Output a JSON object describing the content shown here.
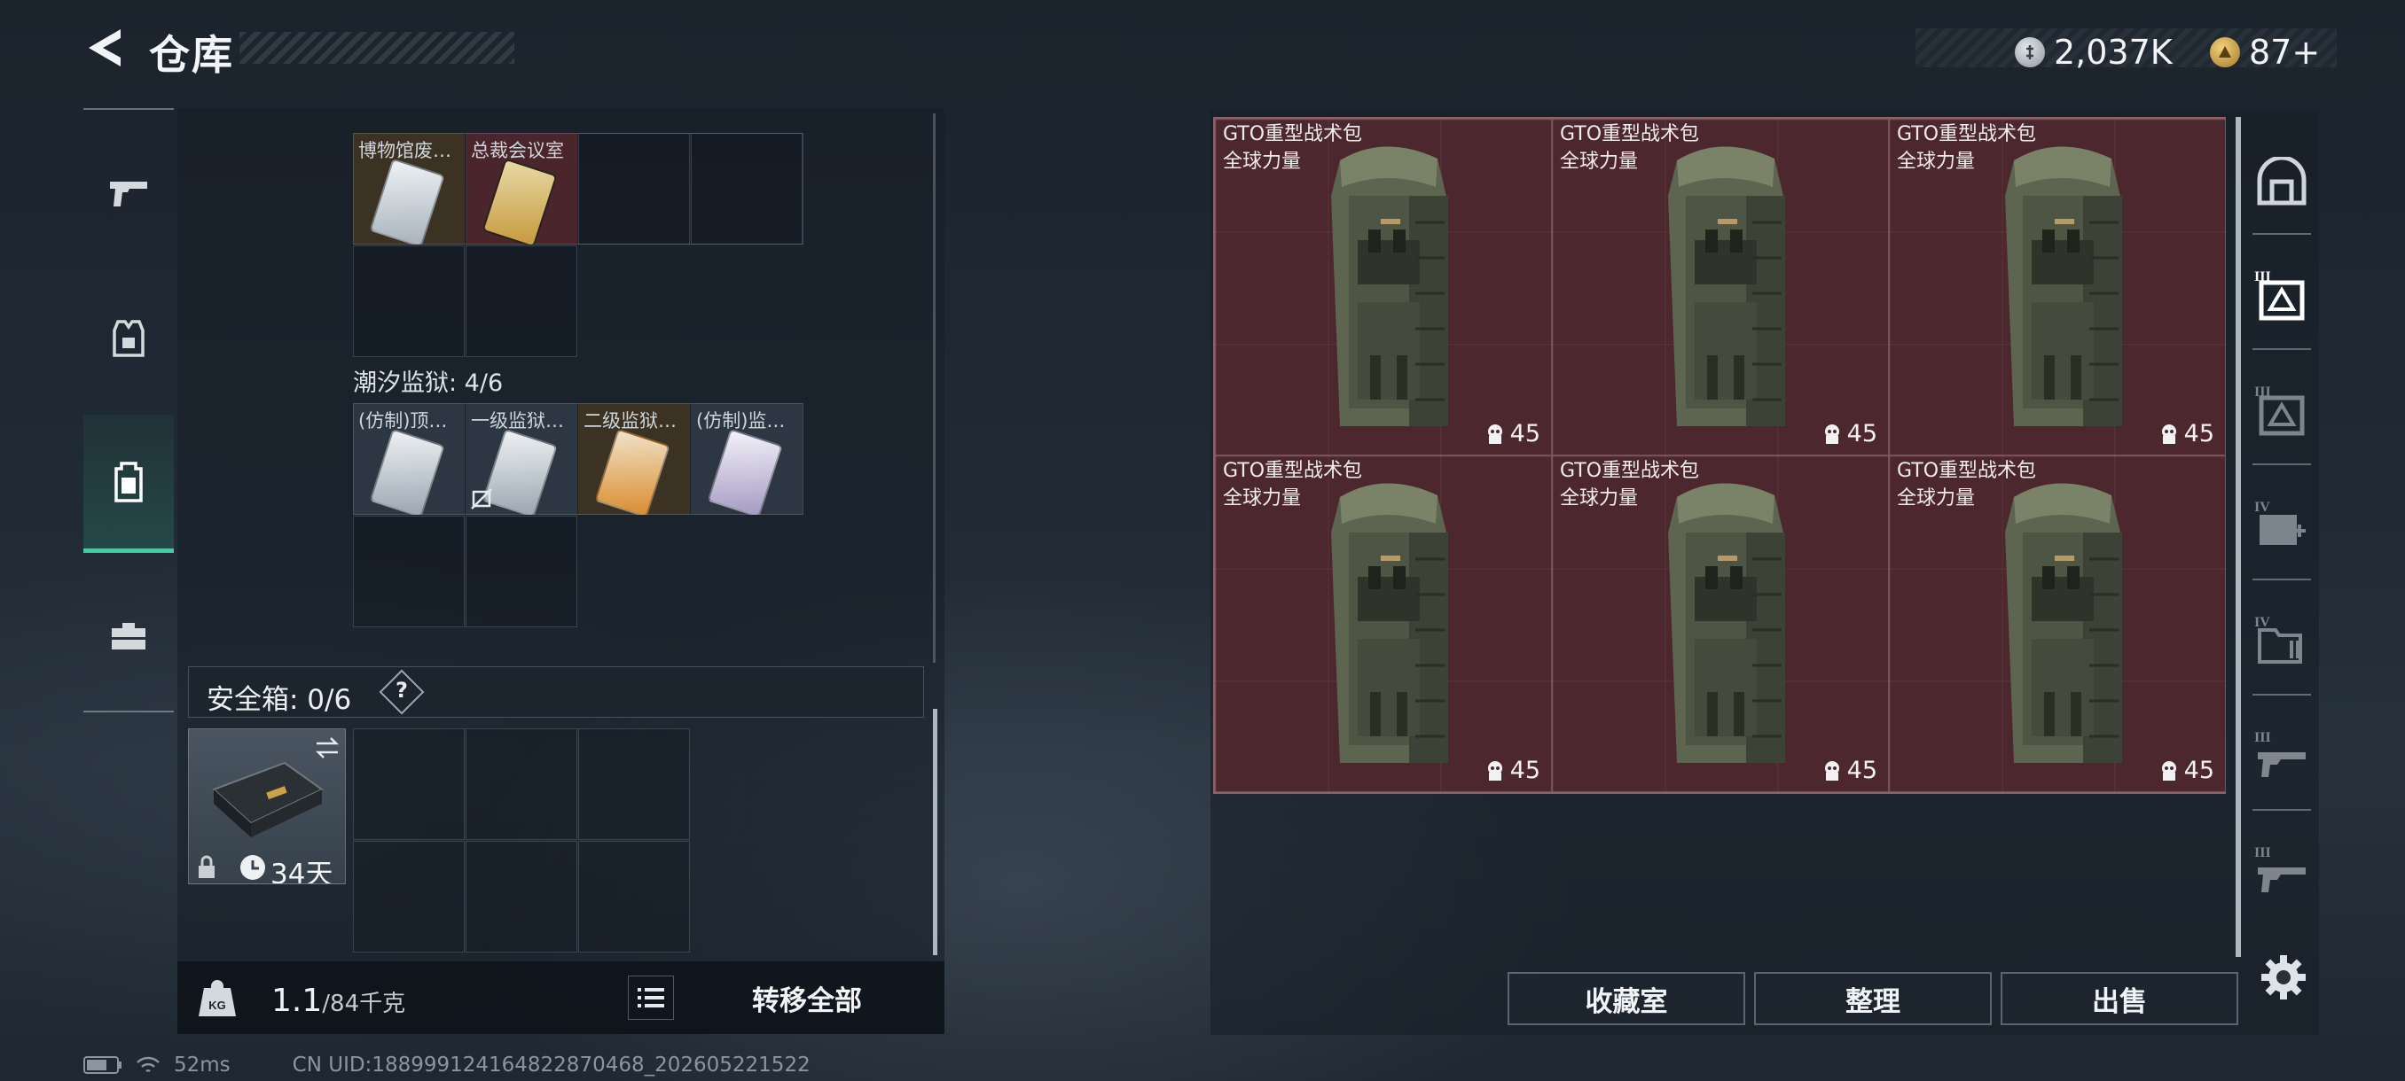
{
  "header": {
    "title": "仓库",
    "currencies": [
      {
        "icon": "silver-coin-icon",
        "value": "2,037K"
      },
      {
        "icon": "gold-coin-icon",
        "value": "87+"
      }
    ]
  },
  "left_nav": [
    {
      "icon": "gun-icon",
      "active": false
    },
    {
      "icon": "armor-vest-icon",
      "active": false
    },
    {
      "icon": "backpack-icon",
      "active": true
    },
    {
      "icon": "toolbox-icon",
      "active": false
    }
  ],
  "groups": [
    {
      "label": "",
      "items": [
        {
          "name": "博物馆废…",
          "color": "#a7b3bd"
        },
        {
          "name": "总裁会议室",
          "color": "#c59a3c"
        }
      ]
    },
    {
      "label": "潮汐监狱: 4/6",
      "items": [
        {
          "name": "(仿制)顶…",
          "color": "#9aa6b2"
        },
        {
          "name": "一级监狱…",
          "color": "#9aa6b2"
        },
        {
          "name": "二级监狱…",
          "color": "#d98c2e"
        },
        {
          "name": "(仿制)监…",
          "color": "#a49bc4"
        }
      ]
    }
  ],
  "safebox": {
    "label": "安全箱: 0/6",
    "help": "?",
    "item_time": "34天"
  },
  "bottom_bar": {
    "weight_icon_label": "KG",
    "weight": "1.1",
    "weight_max": "/84千克",
    "transfer_all": "转移全部"
  },
  "status_bar": {
    "ping": "52ms",
    "uid": "CN UID:18899912416482287046​8_202605221522"
  },
  "storage": {
    "items": [
      {
        "name": "GTO重型战术包",
        "brand": "全球力量",
        "durability": "45"
      },
      {
        "name": "GTO重型战术包",
        "brand": "全球力量",
        "durability": "45"
      },
      {
        "name": "GTO重型战术包",
        "brand": "全球力量",
        "durability": "45"
      },
      {
        "name": "GTO重型战术包",
        "brand": "全球力量",
        "durability": "45"
      },
      {
        "name": "GTO重型战术包",
        "brand": "全球力量",
        "durability": "45"
      },
      {
        "name": "GTO重型战术包",
        "brand": "全球力量",
        "durability": "45"
      }
    ]
  },
  "right_tabs": [
    {
      "icon": "warehouse-main-icon",
      "level": ""
    },
    {
      "icon": "storage-box-icon",
      "level": "III"
    },
    {
      "icon": "storage-box-icon",
      "level": "III"
    },
    {
      "icon": "medical-box-icon",
      "level": "IV"
    },
    {
      "icon": "folder-box-icon",
      "level": "IV"
    },
    {
      "icon": "weapon-rack-icon",
      "level": "III"
    },
    {
      "icon": "weapon-rack-icon",
      "level": "III"
    }
  ],
  "actions": {
    "collection": "收藏室",
    "sort": "整理",
    "sell": "出售"
  }
}
